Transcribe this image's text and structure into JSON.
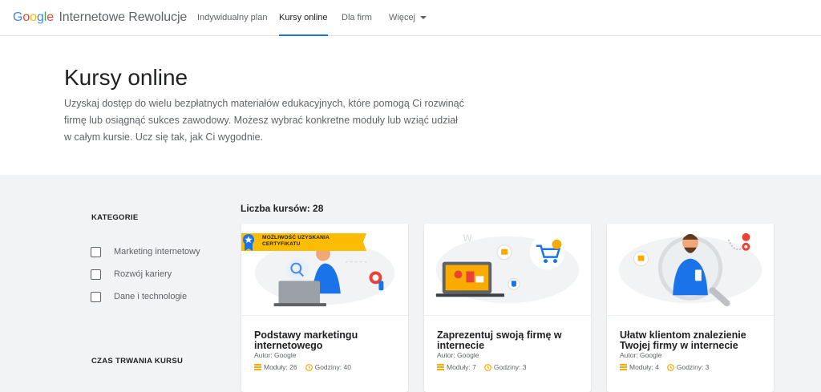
{
  "header": {
    "logo_word": "Google",
    "logo_rest": "Internetowe Rewolucje",
    "nav": [
      {
        "label": "Indywidualny plan"
      },
      {
        "label": "Kursy online"
      },
      {
        "label": "Dla firm"
      },
      {
        "label": "Więcej"
      }
    ]
  },
  "hero": {
    "title": "Kursy online",
    "description": "Uzyskaj dostęp do wielu bezpłatnych materiałów edukacyjnych, które pomogą Ci rozwinąć firmę lub osiągnąć sukces zawodowy. Możesz wybrać konkretne moduły lub wziąć udział w całym kursie. Ucz się tak, jak Ci wygodnie."
  },
  "sidebar": {
    "category_heading": "KATEGORIE",
    "categories": [
      {
        "label": "Marketing internetowy",
        "checked": false
      },
      {
        "label": "Rozwój kariery",
        "checked": false
      },
      {
        "label": "Dane i technologie",
        "checked": false
      }
    ],
    "duration_heading": "CZAS TRWANIA KURSU"
  },
  "courses": {
    "count_label": "Liczba kursów: 28",
    "items": [
      {
        "ribbon": "MOŻLIWOŚĆ UZYSKANIA CERTYFIKATU",
        "title": "Podstawy marketingu internetowego",
        "author": "Autor: Google",
        "modules": "Moduły: 26",
        "hours": "Godziny: 40"
      },
      {
        "ribbon": "",
        "title": "Zaprezentuj swoją firmę w internecie",
        "author": "Autor: Google",
        "modules": "Moduły: 7",
        "hours": "Godziny: 3"
      },
      {
        "ribbon": "",
        "title": "Ułatw klientom znalezienie Twojej firmy w internecie",
        "author": "Autor: Google",
        "modules": "Moduły: 4",
        "hours": "Godziny: 3"
      }
    ]
  },
  "colors": {
    "accent": "#1a73e8",
    "ribbon": "#fbbc04",
    "meta_icon": "#f9ab00"
  }
}
